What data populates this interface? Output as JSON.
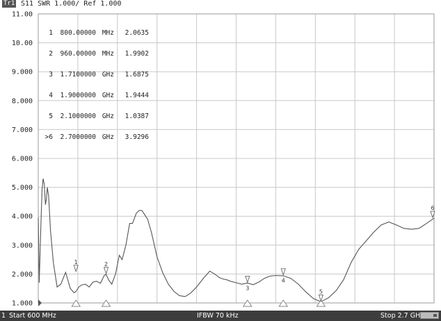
{
  "header": {
    "trace_tag": "Tr1",
    "trace_title": "S11  SWR 1.000/ Ref 1.000"
  },
  "markers": [
    {
      "no": "1",
      "freq": "800.00000",
      "unit": "MHz",
      "value": "2.0635"
    },
    {
      "no": "2",
      "freq": "960.00000",
      "unit": "MHz",
      "value": "1.9902"
    },
    {
      "no": "3",
      "freq": "1.7100000",
      "unit": "GHz",
      "value": "1.6875"
    },
    {
      "no": "4",
      "freq": "1.9000000",
      "unit": "GHz",
      "value": "1.9444"
    },
    {
      "no": "5",
      "freq": "2.1000000",
      "unit": "GHz",
      "value": "1.0387"
    },
    {
      "no": ">6",
      "freq": "2.7000000",
      "unit": "GHz",
      "value": "3.9296"
    }
  ],
  "status": {
    "channel": "1",
    "start": "Start 600 MHz",
    "ifbw": "IFBW 70 kHz",
    "stop": "Stop 2.7 GHz"
  },
  "colors": {
    "trace": "#555555",
    "grid": "#c8c8c8",
    "status_bg": "#3d3d3d"
  },
  "chart_data": {
    "type": "line",
    "ylim": [
      1,
      11
    ],
    "xlim": [
      0.6,
      2.7
    ],
    "x_unit": "GHz",
    "grid": true,
    "yticks": [
      "11.00",
      "10.00",
      "9.000",
      "8.000",
      "7.000",
      "6.000",
      "5.000",
      "4.000",
      "3.000",
      "2.000",
      "1.000"
    ],
    "series": [
      {
        "x": [
          0.6,
          0.605,
          0.612,
          0.62,
          0.626,
          0.632,
          0.638,
          0.643,
          0.648,
          0.655,
          0.665,
          0.68,
          0.7,
          0.72,
          0.745,
          0.77,
          0.79,
          0.8,
          0.815,
          0.83,
          0.85,
          0.87,
          0.89,
          0.91,
          0.93,
          0.95,
          0.96,
          0.975,
          0.99,
          1.01,
          1.03,
          1.045,
          1.065,
          1.085,
          1.1,
          1.12,
          1.135,
          1.15,
          1.18,
          1.2,
          1.23,
          1.26,
          1.29,
          1.32,
          1.35,
          1.38,
          1.41,
          1.44,
          1.48,
          1.51,
          1.54,
          1.56,
          1.58,
          1.6,
          1.62,
          1.65,
          1.68,
          1.71,
          1.74,
          1.77,
          1.8,
          1.83,
          1.86,
          1.9,
          1.94,
          1.98,
          2.02,
          2.06,
          2.1,
          2.14,
          2.18,
          2.22,
          2.26,
          2.3,
          2.34,
          2.38,
          2.42,
          2.46,
          2.5,
          2.54,
          2.58,
          2.62,
          2.66,
          2.7
        ],
        "values": [
          3.95,
          1.7,
          3.3,
          4.9,
          5.3,
          5.1,
          4.4,
          4.6,
          5.0,
          4.7,
          3.5,
          2.4,
          1.55,
          1.65,
          2.06,
          1.5,
          1.35,
          1.4,
          1.55,
          1.62,
          1.65,
          1.55,
          1.72,
          1.75,
          1.68,
          1.95,
          1.99,
          1.78,
          1.65,
          2.0,
          2.65,
          2.5,
          3.0,
          3.75,
          3.75,
          4.1,
          4.2,
          4.2,
          3.9,
          3.45,
          2.6,
          2.05,
          1.65,
          1.4,
          1.25,
          1.22,
          1.35,
          1.55,
          1.88,
          2.1,
          1.98,
          1.88,
          1.83,
          1.8,
          1.75,
          1.7,
          1.65,
          1.69,
          1.63,
          1.72,
          1.85,
          1.93,
          1.95,
          1.94,
          1.85,
          1.65,
          1.38,
          1.15,
          1.04,
          1.18,
          1.42,
          1.8,
          2.4,
          2.85,
          3.15,
          3.45,
          3.7,
          3.8,
          3.7,
          3.58,
          3.55,
          3.58,
          3.75,
          3.93
        ]
      }
    ],
    "markers_x": [
      0.8,
      0.96,
      1.71,
      1.9,
      2.1,
      2.7
    ],
    "marker_labels": [
      "1",
      "2",
      "3",
      "4",
      "5",
      "6"
    ]
  }
}
